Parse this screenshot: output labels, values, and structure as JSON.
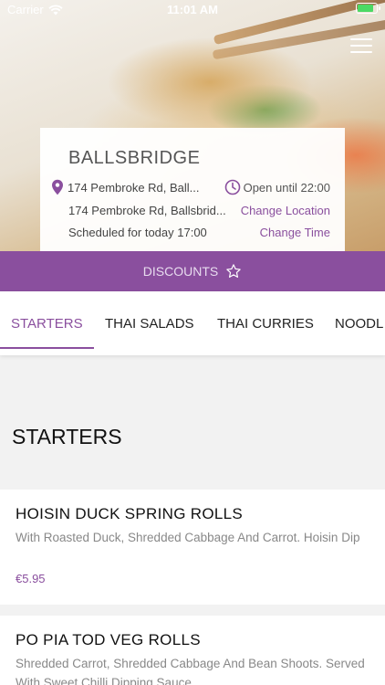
{
  "status_bar": {
    "carrier": "Carrier",
    "time": "11:01 AM"
  },
  "restaurant": {
    "name": "BALLSBRIDGE",
    "address_short": "174 Pembroke Rd, Ball...",
    "hours": "Open until 22:00",
    "address_full": "174 Pembroke Rd, Ballsbrid...",
    "change_location": "Change Location",
    "schedule": "Scheduled for today 17:00",
    "change_time": "Change Time"
  },
  "discounts": {
    "label": "DISCOUNTS"
  },
  "tabs": [
    {
      "label": "STARTERS",
      "active": true
    },
    {
      "label": "THAI SALADS"
    },
    {
      "label": "THAI CURRIES"
    },
    {
      "label": "NOODL"
    }
  ],
  "section": {
    "title": "STARTERS"
  },
  "items": [
    {
      "name": "HOISIN DUCK SPRING ROLLS",
      "description": "With Roasted Duck, Shredded Cabbage And Carrot. Hoisin Dip",
      "price": "€5.95"
    },
    {
      "name": "PO PIA TOD VEG ROLLS",
      "description": "Shredded Carrot, Shredded Cabbage And Bean Shoots. Served With Sweet Chilli Dipping Sauce"
    }
  ],
  "colors": {
    "accent": "#8a4f9e",
    "battery": "#4cd964"
  }
}
